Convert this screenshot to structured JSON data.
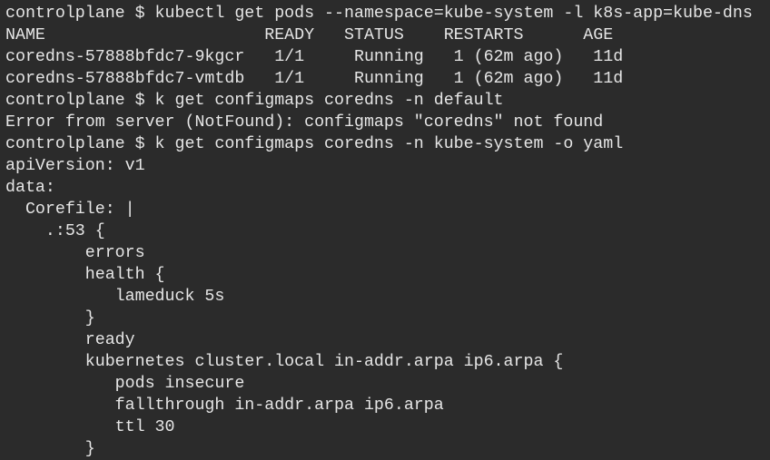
{
  "terminal": {
    "lines": [
      "controlplane $ kubectl get pods --namespace=kube-system -l k8s-app=kube-dns",
      "NAME                      READY   STATUS    RESTARTS      AGE",
      "coredns-57888bfdc7-9kgcr   1/1     Running   1 (62m ago)   11d",
      "coredns-57888bfdc7-vmtdb   1/1     Running   1 (62m ago)   11d",
      "controlplane $ k get configmaps coredns -n default",
      "Error from server (NotFound): configmaps \"coredns\" not found",
      "controlplane $ k get configmaps coredns -n kube-system -o yaml",
      "apiVersion: v1",
      "data:",
      "  Corefile: |",
      "    .:53 {",
      "        errors",
      "        health {",
      "           lameduck 5s",
      "        }",
      "        ready",
      "        kubernetes cluster.local in-addr.arpa ip6.arpa {",
      "           pods insecure",
      "           fallthrough in-addr.arpa ip6.arpa",
      "           ttl 30",
      "        }"
    ]
  }
}
